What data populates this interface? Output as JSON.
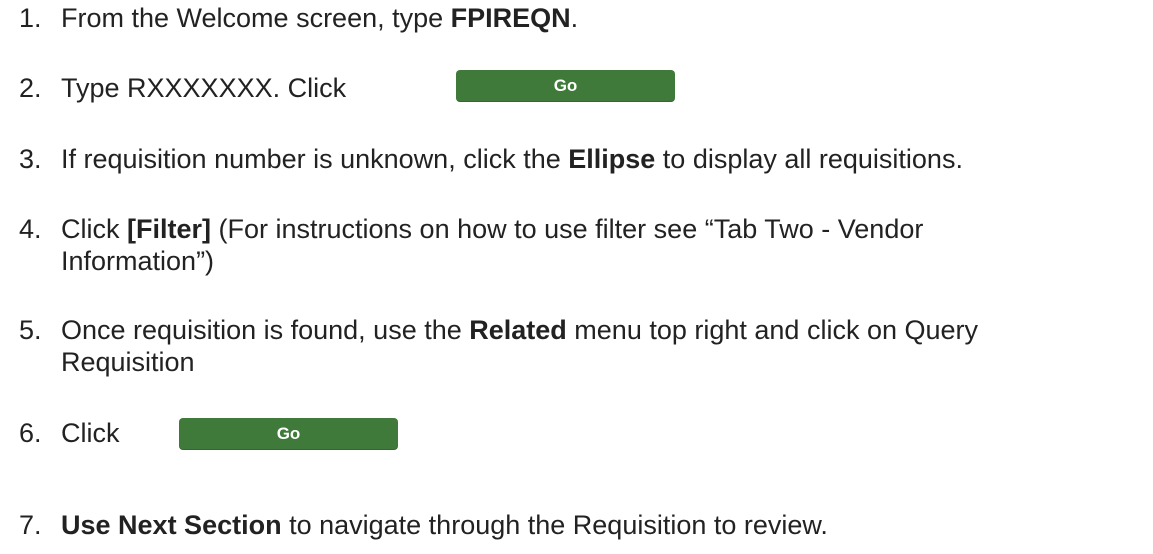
{
  "steps": [
    {
      "number": "1.",
      "text_before": "From the Welcome screen, type ",
      "bold": "FPIREQN",
      "text_after": "."
    },
    {
      "number": "2.",
      "text": "Type RXXXXXXX.  Click",
      "button_label": "Go"
    },
    {
      "number": "3.",
      "text_before": "If requisition number is unknown, click the ",
      "bold": "Ellipse",
      "text_after": " to display all requisitions."
    },
    {
      "number": "4.",
      "text_before": "Click ",
      "bold": "[Filter]",
      "text_after": " (For instructions on how to use filter see “Tab Two - Vendor",
      "continuation": "Information”)"
    },
    {
      "number": "5.",
      "text_before": "Once requisition is found, use the ",
      "bold": "Related",
      "text_after": " menu top right and click on Query",
      "continuation": "Requisition"
    },
    {
      "number": "6.",
      "text": "Click",
      "button_label": "Go"
    },
    {
      "number": "7.",
      "bold": "Use Next Section",
      "text_after": " to navigate through the Requisition to review."
    }
  ],
  "colors": {
    "button_bg": "#3f7a3a",
    "button_text": "#ffffff",
    "body_text": "#222222"
  }
}
